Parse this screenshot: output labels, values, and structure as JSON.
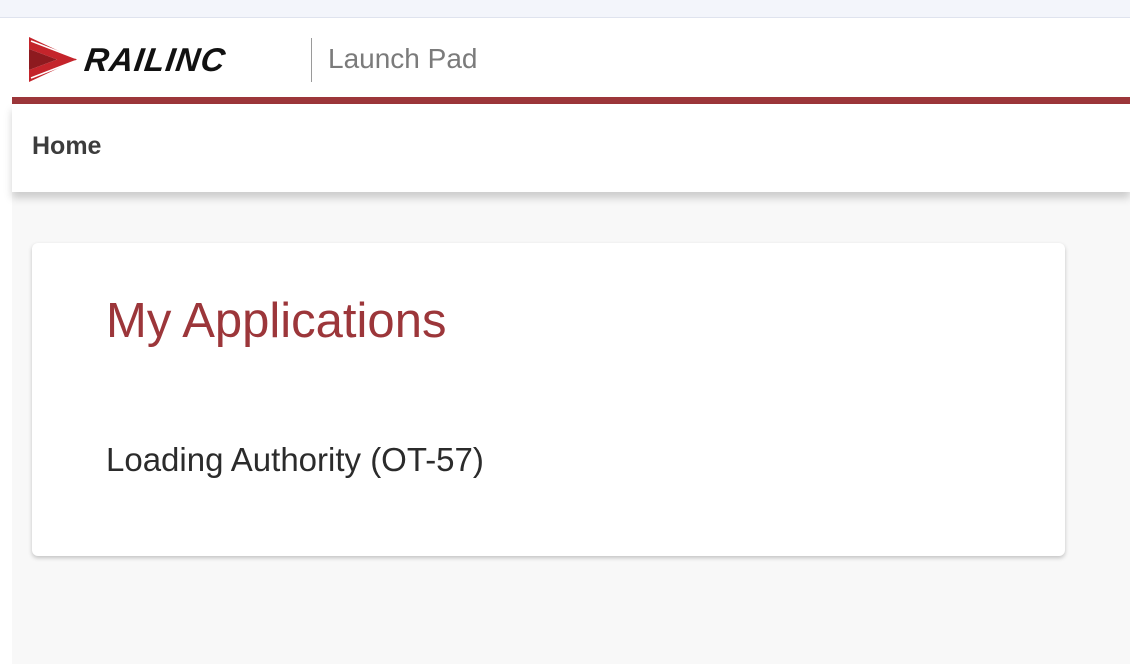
{
  "header": {
    "logo_text": "RAILINC",
    "title": "Launch Pad"
  },
  "nav": {
    "home_label": "Home"
  },
  "main": {
    "card_title": "My Applications",
    "applications": [
      {
        "label": "Loading Authority (OT-57)"
      }
    ]
  },
  "colors": {
    "brand_accent": "#9c363a",
    "logo_red": "#c4242b",
    "background": "#f8f8f8"
  }
}
